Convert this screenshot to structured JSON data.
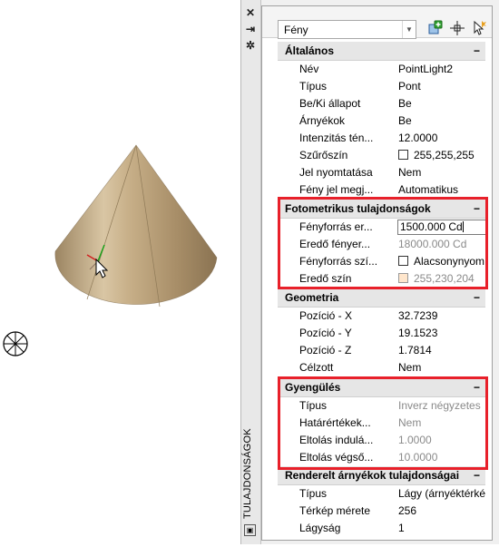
{
  "palette_title": "TULAJDONSÁGOK",
  "object_type": "Fény",
  "groups": {
    "general": {
      "title": "Általános",
      "collapse": "−",
      "rows": [
        {
          "label": "Név",
          "value": "PointLight2"
        },
        {
          "label": "Típus",
          "value": "Pont"
        },
        {
          "label": "Be/Ki állapot",
          "value": "Be"
        },
        {
          "label": "Árnyékok",
          "value": "Be"
        },
        {
          "label": "Intenzitás tén...",
          "value": "12.0000"
        },
        {
          "label": "Szűrőszín",
          "value": "255,255,255"
        },
        {
          "label": "Jel nyomtatása",
          "value": "Nem"
        },
        {
          "label": "Fény jel megj...",
          "value": "Automatikus"
        }
      ]
    },
    "photometric": {
      "title": "Fotometrikus tulajdonságok",
      "collapse": "−",
      "rows": [
        {
          "label": "Fényforrás er...",
          "value": "1500.000 Cd"
        },
        {
          "label": "Eredő fényer...",
          "value": "18000.000 Cd"
        },
        {
          "label": "Fényforrás szí...",
          "value": "Alacsonynyom..."
        },
        {
          "label": "Eredő szín",
          "value": "255,230,204"
        }
      ]
    },
    "geometry": {
      "title": "Geometria",
      "collapse": "−",
      "rows": [
        {
          "label": "Pozíció - X",
          "value": "32.7239"
        },
        {
          "label": "Pozíció - Y",
          "value": "19.1523"
        },
        {
          "label": "Pozíció - Z",
          "value": "1.7814"
        },
        {
          "label": "Célzott",
          "value": "Nem"
        }
      ]
    },
    "attenuation": {
      "title": "Gyengülés",
      "collapse": "−",
      "rows": [
        {
          "label": "Típus",
          "value": "Inverz négyzetes"
        },
        {
          "label": "Határértékek...",
          "value": "Nem"
        },
        {
          "label": "Eltolás indulá...",
          "value": "1.0000"
        },
        {
          "label": "Eltolás végső...",
          "value": "10.0000"
        }
      ]
    },
    "rendered_shadows": {
      "title": "Renderelt árnyékok tulajdonságai",
      "collapse": "−",
      "rows": [
        {
          "label": "Típus",
          "value": "Lágy (árnyéktérkép)"
        },
        {
          "label": "Térkép mérete",
          "value": "256"
        },
        {
          "label": "Lágyság",
          "value": "1"
        }
      ]
    }
  },
  "colors": {
    "highlight": "#e8202a",
    "cone_base": "#b59a72",
    "disabled_text": "#8a8a8a"
  }
}
